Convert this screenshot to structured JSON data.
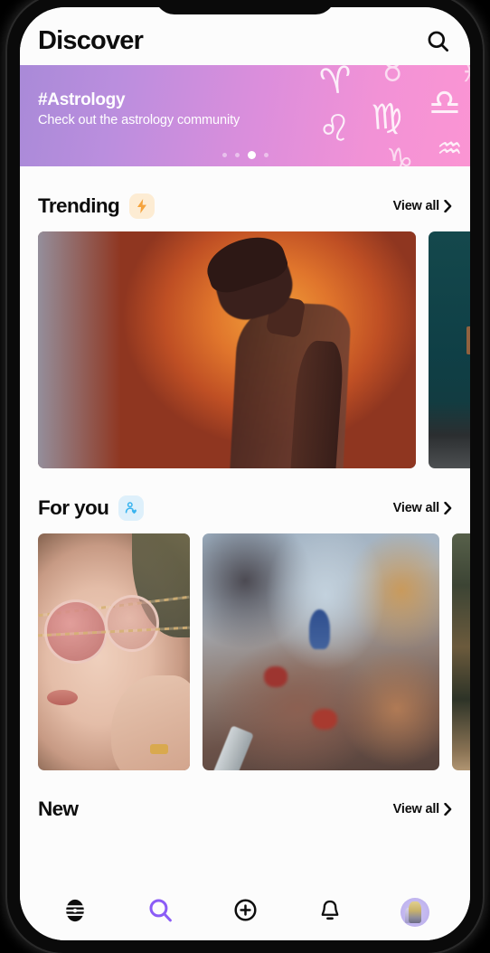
{
  "header": {
    "title": "Discover",
    "search_icon": "search-icon"
  },
  "banner": {
    "title": "#Astrology",
    "subtitle": "Check out the astrology community",
    "gradient_from": "#a98ad8",
    "gradient_to": "#fb95d3",
    "zodiac_symbols": [
      "♈",
      "♉",
      "♌",
      "♍",
      "♎",
      "♒",
      "♑",
      "♓"
    ],
    "dots": {
      "count": 4,
      "active_index": 2
    }
  },
  "sections": [
    {
      "title": "Trending",
      "badge_icon": "lightning-bolt-icon",
      "badge_color": "#fdecd3",
      "view_all_label": "View all",
      "cards": [
        {
          "name": "trending-card-silhouette",
          "art": "silhouette"
        },
        {
          "name": "trending-card-teal",
          "art": "teal"
        }
      ]
    },
    {
      "title": "For you",
      "badge_icon": "person-heart-icon",
      "badge_color": "#def0fb",
      "view_all_label": "View all",
      "cards": [
        {
          "name": "foryou-card-portrait",
          "art": "portrait"
        },
        {
          "name": "foryou-card-fresco",
          "art": "fresco"
        },
        {
          "name": "foryou-card-forest",
          "art": "forest"
        }
      ]
    },
    {
      "title": "New",
      "badge_icon": "",
      "view_all_label": "View all",
      "cards": []
    }
  ],
  "bottom_nav": {
    "active_color": "#8b5cf6",
    "inactive_color": "#0d0d0d",
    "items": [
      {
        "name": "nav-home",
        "icon": "beehive-icon",
        "active": false
      },
      {
        "name": "nav-search",
        "icon": "search-icon",
        "active": true
      },
      {
        "name": "nav-create",
        "icon": "plus-circle-icon",
        "active": false
      },
      {
        "name": "nav-notifications",
        "icon": "bell-icon",
        "active": false
      },
      {
        "name": "nav-profile",
        "icon": "avatar-icon",
        "active": false
      }
    ]
  }
}
